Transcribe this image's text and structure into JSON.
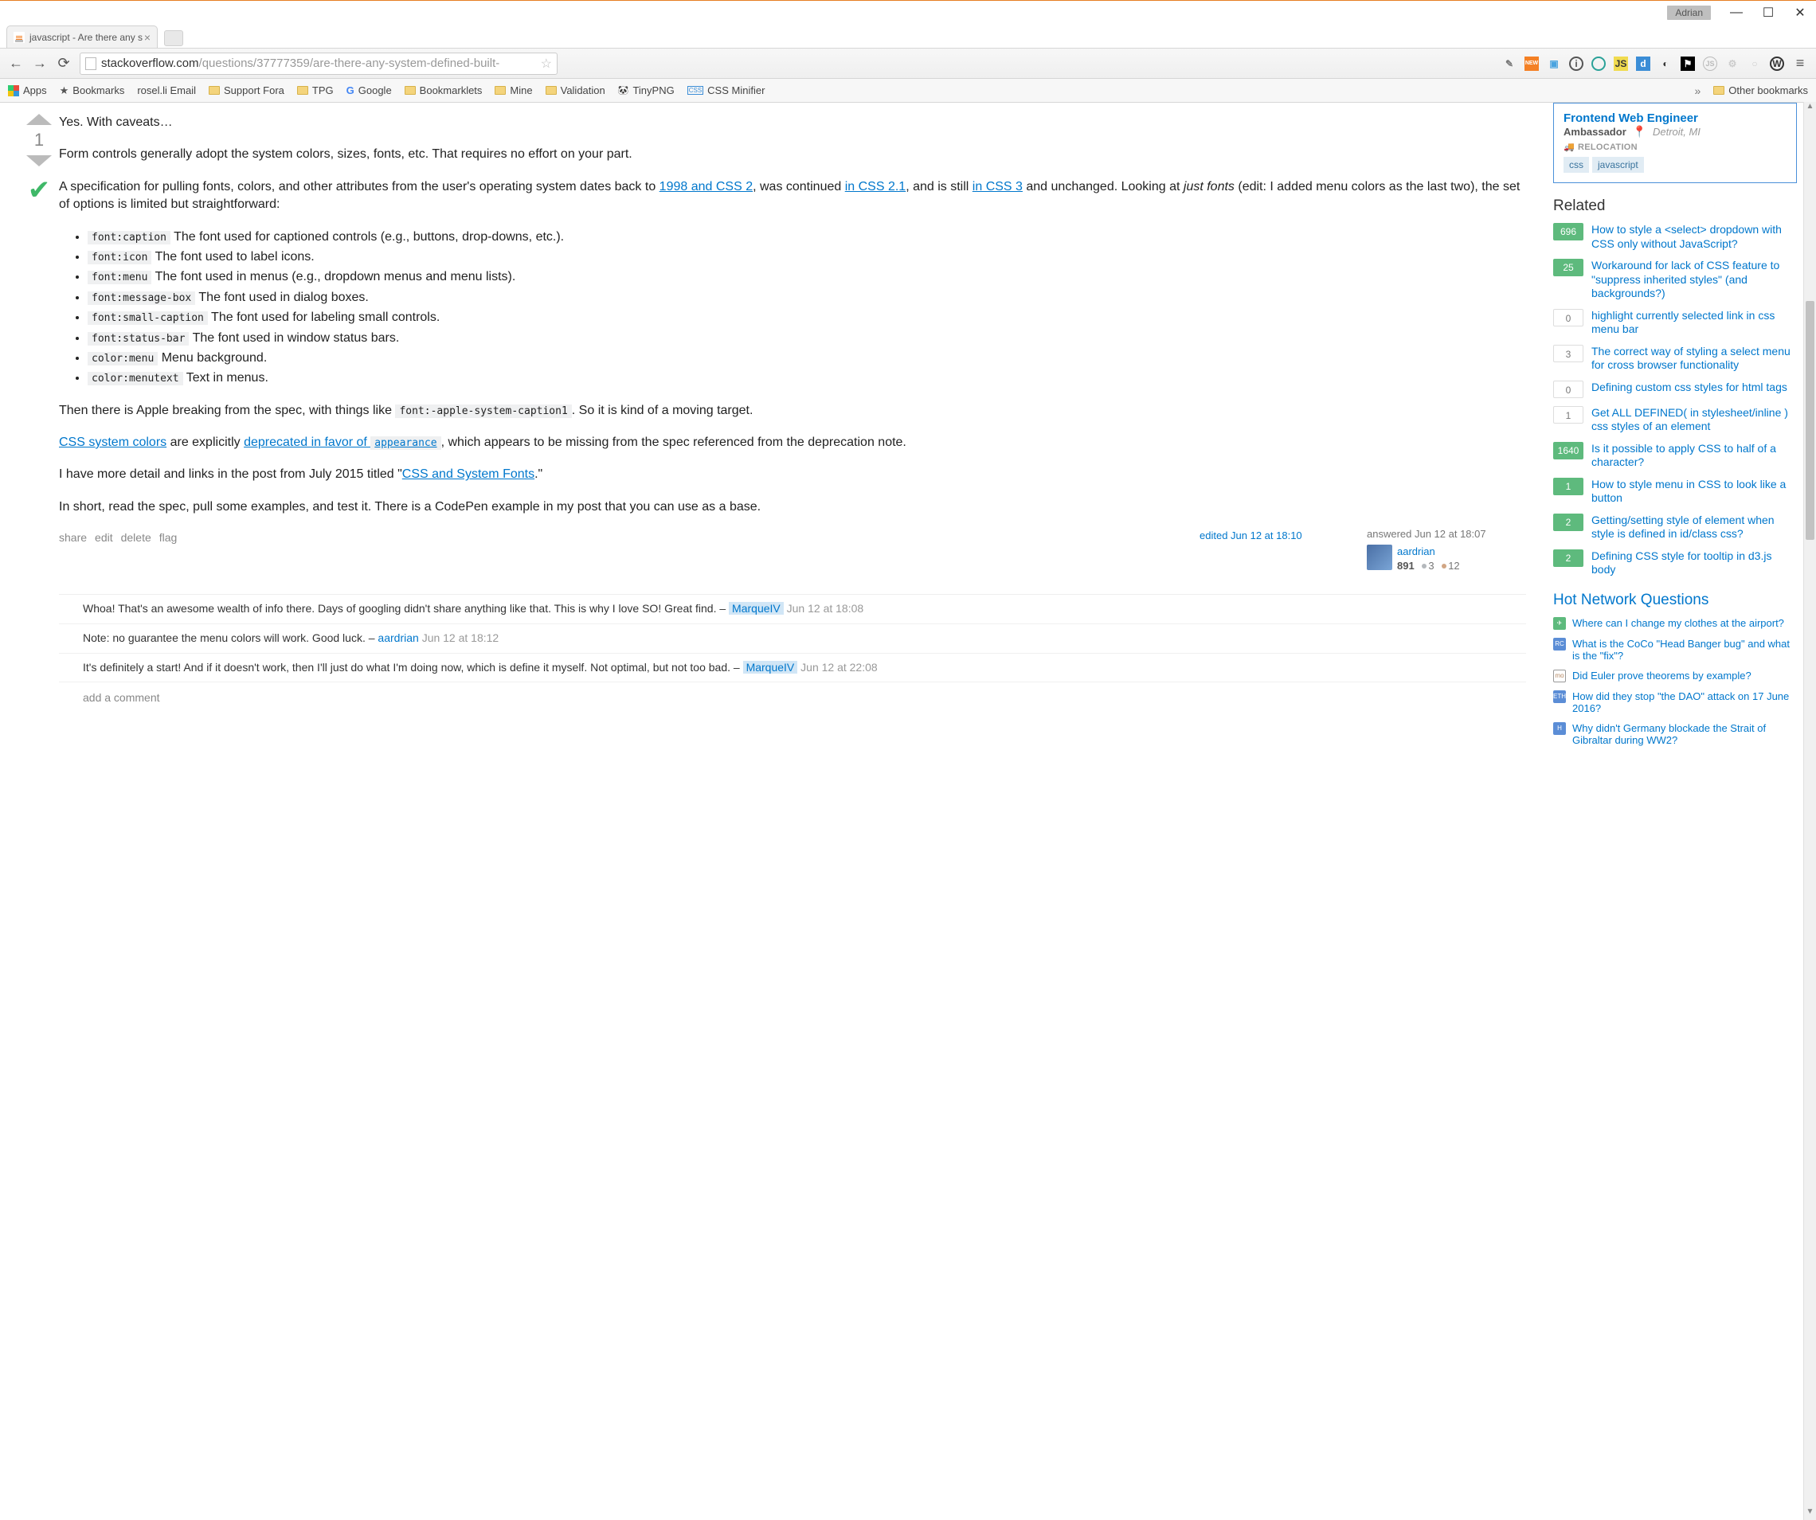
{
  "window": {
    "user_tag": "Adrian",
    "tab_title": "javascript - Are there any s"
  },
  "nav": {
    "url_host": "stackoverflow.com",
    "url_path": "/questions/37777359/are-there-any-system-defined-built-"
  },
  "bookmarks": {
    "apps": "Apps",
    "bookmarks": "Bookmarks",
    "roselli": "rosel.li Email",
    "support": "Support Fora",
    "tpg": "TPG",
    "google": "Google",
    "bklets": "Bookmarklets",
    "mine": "Mine",
    "validation": "Validation",
    "tinypng": "TinyPNG",
    "cssmin": "CSS Minifier",
    "other": "Other bookmarks"
  },
  "answer": {
    "score": "1",
    "p1": "Yes. With caveats…",
    "p2": "Form controls generally adopt the system colors, sizes, fonts, etc. That requires no effort on your part.",
    "p3a": "A specification for pulling fonts, colors, and other attributes from the user's operating system dates back to ",
    "p3_link1": "1998 and CSS 2",
    "p3b": ", was continued ",
    "p3_link2": "in CSS 2.1",
    "p3c": ", and is still ",
    "p3_link3": "in CSS 3",
    "p3d": " and unchanged. Looking at ",
    "p3_em": "just fonts",
    "p3e": " (edit: I added menu colors as the last two), the set of options is limited but straightforward:",
    "fonts": [
      {
        "code": "font:caption",
        "desc": "The font used for captioned controls (e.g., buttons, drop-downs, etc.)."
      },
      {
        "code": "font:icon",
        "desc": "The font used to label icons."
      },
      {
        "code": "font:menu",
        "desc": "The font used in menus (e.g., dropdown menus and menu lists)."
      },
      {
        "code": "font:message-box",
        "desc": "The font used in dialog boxes."
      },
      {
        "code": "font:small-caption",
        "desc": "The font used for labeling small controls."
      },
      {
        "code": "font:status-bar",
        "desc": "The font used in window status bars."
      },
      {
        "code": "color:menu",
        "desc": "Menu background."
      },
      {
        "code": "color:menutext",
        "desc": "Text in menus."
      }
    ],
    "p4a": "Then there is Apple breaking from the spec, with things like ",
    "p4_code": "font:-apple-system-caption1",
    "p4b": ". So it is kind of a moving target.",
    "p5_link1": "CSS system colors",
    "p5a": " are explicitly ",
    "p5_link2": "deprecated in favor of ",
    "p5_code": "appearance",
    "p5b": ", which appears to be missing from the spec referenced from the deprecation note.",
    "p6a": "I have more detail and links in the post from July 2015 titled \"",
    "p6_link": "CSS and System Fonts",
    "p6b": ".\"",
    "p7": "In short, read the spec, pull some examples, and test it. There is a CodePen example in my post that you can use as a base.",
    "actions": {
      "share": "share",
      "edit": "edit",
      "delete": "delete",
      "flag": "flag"
    },
    "edited": "edited Jun 12 at 18:10",
    "answered": "answered Jun 12 at 18:07",
    "author": "aardrian",
    "rep": "891",
    "silver": "3",
    "bronze": "12"
  },
  "comments": [
    {
      "text": "Whoa! That's an awesome wealth of info there. Days of googling didn't share anything like that. This is why I love SO! Great find. – ",
      "user": "MarqueIV",
      "time": "Jun 12 at 18:08",
      "owner": true
    },
    {
      "text": "Note: no guarantee the menu colors will work. Good luck. – ",
      "user": "aardrian",
      "time": "Jun 12 at 18:12",
      "owner": false
    },
    {
      "text": "It's definitely a start! And if it doesn't work, then I'll just do what I'm doing now, which is define it myself. Not optimal, but not too bad. – ",
      "user": "MarqueIV",
      "time": "Jun 12 at 22:08",
      "owner": true
    }
  ],
  "add_comment": "add a comment",
  "job": {
    "title": "Frontend Web Engineer",
    "company": "Ambassador",
    "location": "Detroit, MI",
    "relocation": "RELOCATION",
    "tags": [
      "css",
      "javascript"
    ]
  },
  "related_heading": "Related",
  "related": [
    {
      "count": "696",
      "answered": true,
      "title": "How to style a <select> dropdown with CSS only without JavaScript?"
    },
    {
      "count": "25",
      "answered": true,
      "title": "Workaround for lack of CSS feature to \"suppress inherited styles\" (and backgrounds?)"
    },
    {
      "count": "0",
      "answered": false,
      "title": "highlight currently selected link in css menu bar"
    },
    {
      "count": "3",
      "answered": false,
      "title": "The correct way of styling a select menu for cross browser functionality"
    },
    {
      "count": "0",
      "answered": false,
      "title": "Defining custom css styles for html tags"
    },
    {
      "count": "1",
      "answered": false,
      "title": "Get ALL DEFINED( in stylesheet/inline ) css styles of an element"
    },
    {
      "count": "1640",
      "answered": true,
      "title": "Is it possible to apply CSS to half of a character?"
    },
    {
      "count": "1",
      "answered": true,
      "title": "How to style menu in CSS to look like a button"
    },
    {
      "count": "2",
      "answered": true,
      "title": "Getting/setting style of element when style is defined in id/class css?"
    },
    {
      "count": "2",
      "answered": true,
      "title": "Defining CSS style for tooltip in d3.js body"
    }
  ],
  "hot_heading": "Hot Network Questions",
  "hot": [
    {
      "icon_bg": "#5eba7d",
      "icon_text": "✈",
      "title": "Where can I change my clothes at the airport?"
    },
    {
      "icon_bg": "#5b8dd6",
      "icon_text": "RC",
      "title": "What is the CoCo \"Head Banger bug\" and what is the \"fix\"?"
    },
    {
      "icon_bg": "#fff",
      "icon_text": "mo",
      "title": "Did Euler prove theorems by example?",
      "border": true
    },
    {
      "icon_bg": "#5b8dd6",
      "icon_text": "ETH",
      "title": "How did they stop \"the DAO\" attack on 17 June 2016?"
    },
    {
      "icon_bg": "#5b8dd6",
      "icon_text": "H",
      "title": "Why didn't Germany blockade the Strait of Gibraltar during WW2?"
    }
  ]
}
